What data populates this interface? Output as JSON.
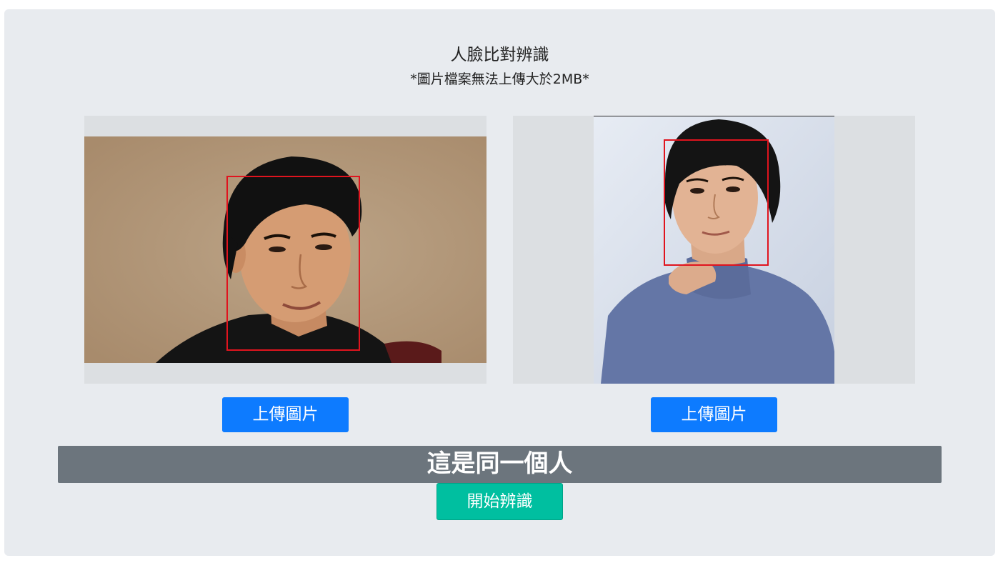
{
  "header": {
    "title": "人臉比對辨識",
    "subtitle": "*圖片檔案無法上傳大於2MB*"
  },
  "images": [
    {
      "name": "photo-1",
      "upload_label": "上傳圖片"
    },
    {
      "name": "photo-2",
      "upload_label": "上傳圖片"
    }
  ],
  "result": {
    "text": "這是同一個人"
  },
  "actions": {
    "start_label": "開始辨識"
  },
  "colors": {
    "panel_bg": "#e8ebef",
    "upload_button": "#0d7bff",
    "result_bar": "#6c757d",
    "start_button": "#00bfa0",
    "face_box": "#e0141e"
  }
}
